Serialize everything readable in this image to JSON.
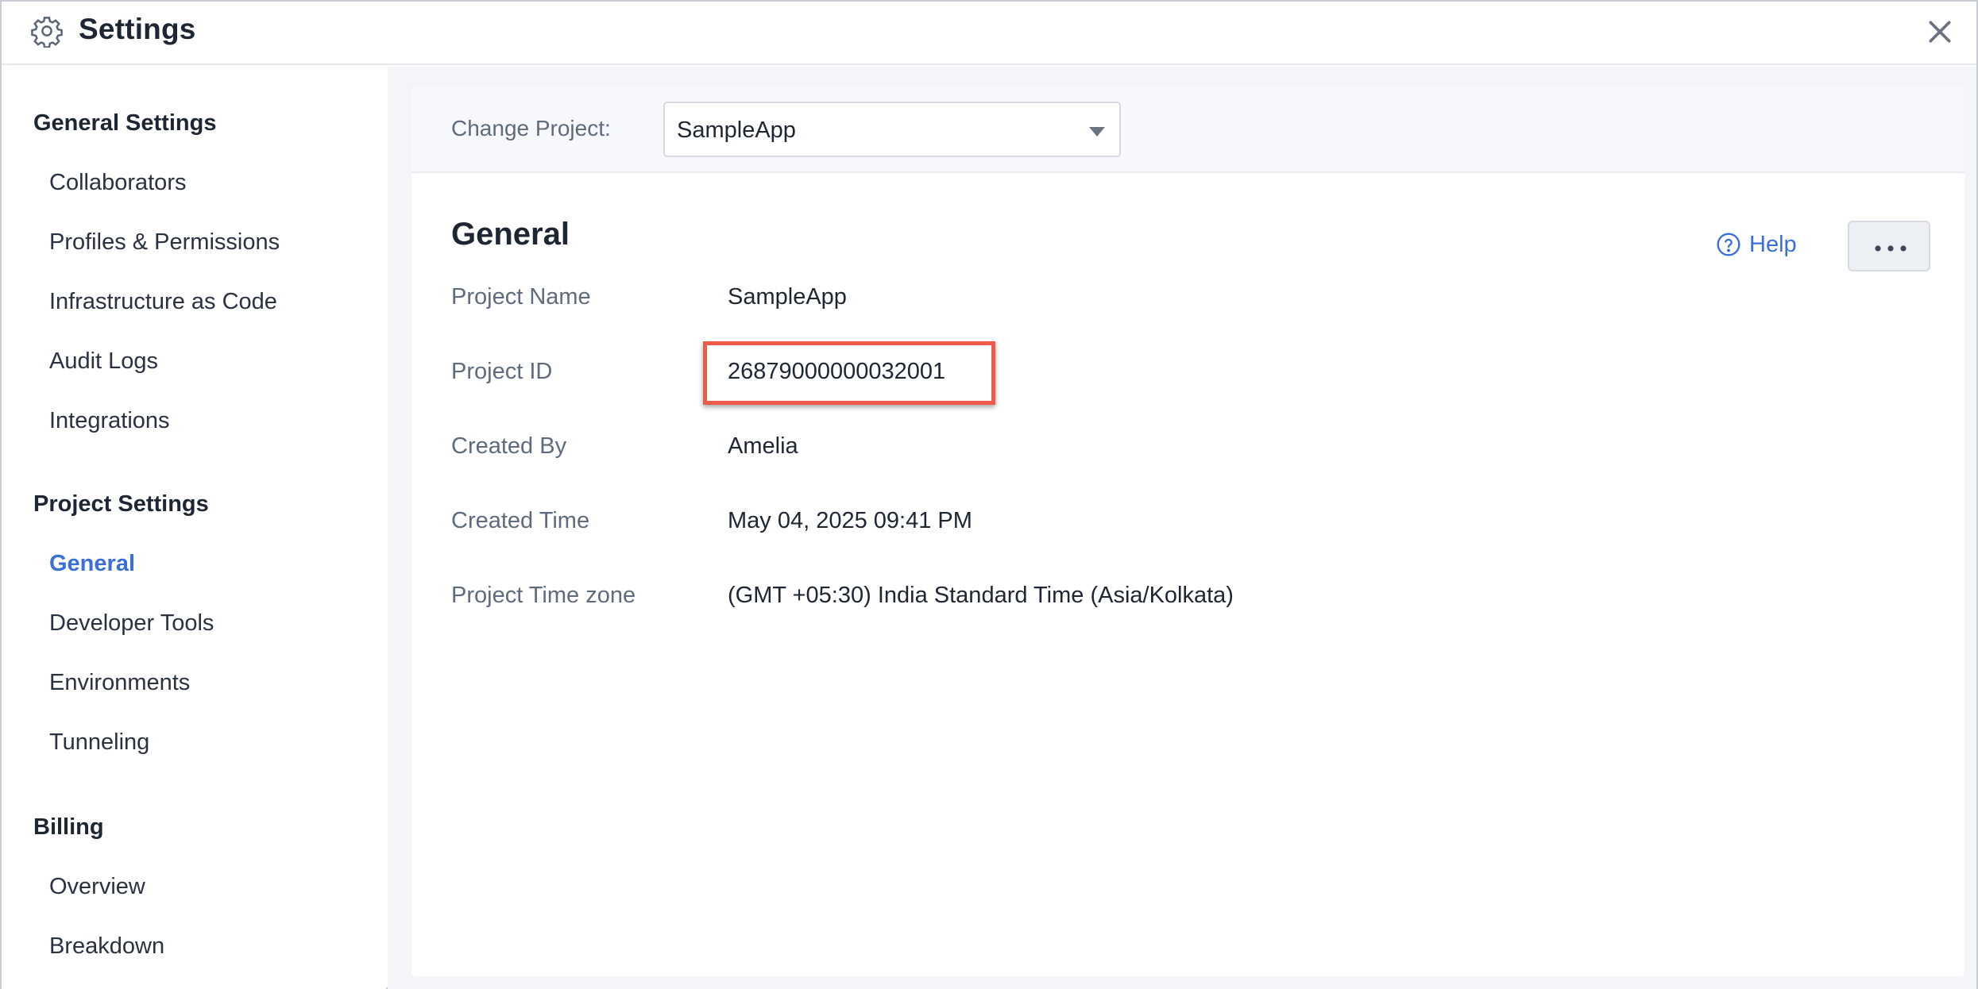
{
  "titlebar": {
    "title": "Settings",
    "icon": "gear-icon",
    "close_icon": "close-icon"
  },
  "sidebar": {
    "sections": [
      {
        "label": "General Settings",
        "items": [
          "Collaborators",
          "Profiles & Permissions",
          "Infrastructure as Code",
          "Audit Logs",
          "Integrations"
        ]
      },
      {
        "label": "Project Settings",
        "items": [
          "General",
          "Developer Tools",
          "Environments",
          "Tunneling"
        ]
      },
      {
        "label": "Billing",
        "items": [
          "Overview",
          "Breakdown"
        ]
      }
    ],
    "active_item": "General"
  },
  "main": {
    "change_project_label": "Change Project:",
    "project_select_value": "SampleApp",
    "section_title": "General",
    "help_label": "Help",
    "fields": [
      {
        "label": "Project Name",
        "value": "SampleApp"
      },
      {
        "label": "Project ID",
        "value": "26879000000032001"
      },
      {
        "label": "Created By",
        "value": "Amelia"
      },
      {
        "label": "Created Time",
        "value": "May 04, 2025 09:41 PM"
      },
      {
        "label": "Project Time zone",
        "value": "(GMT +05:30) India Standard Time (Asia/Kolkata)"
      }
    ]
  },
  "colors": {
    "accent": "#3b6fd8",
    "highlight_border": "#f05a4a",
    "main_background": "#f3f5f9"
  }
}
